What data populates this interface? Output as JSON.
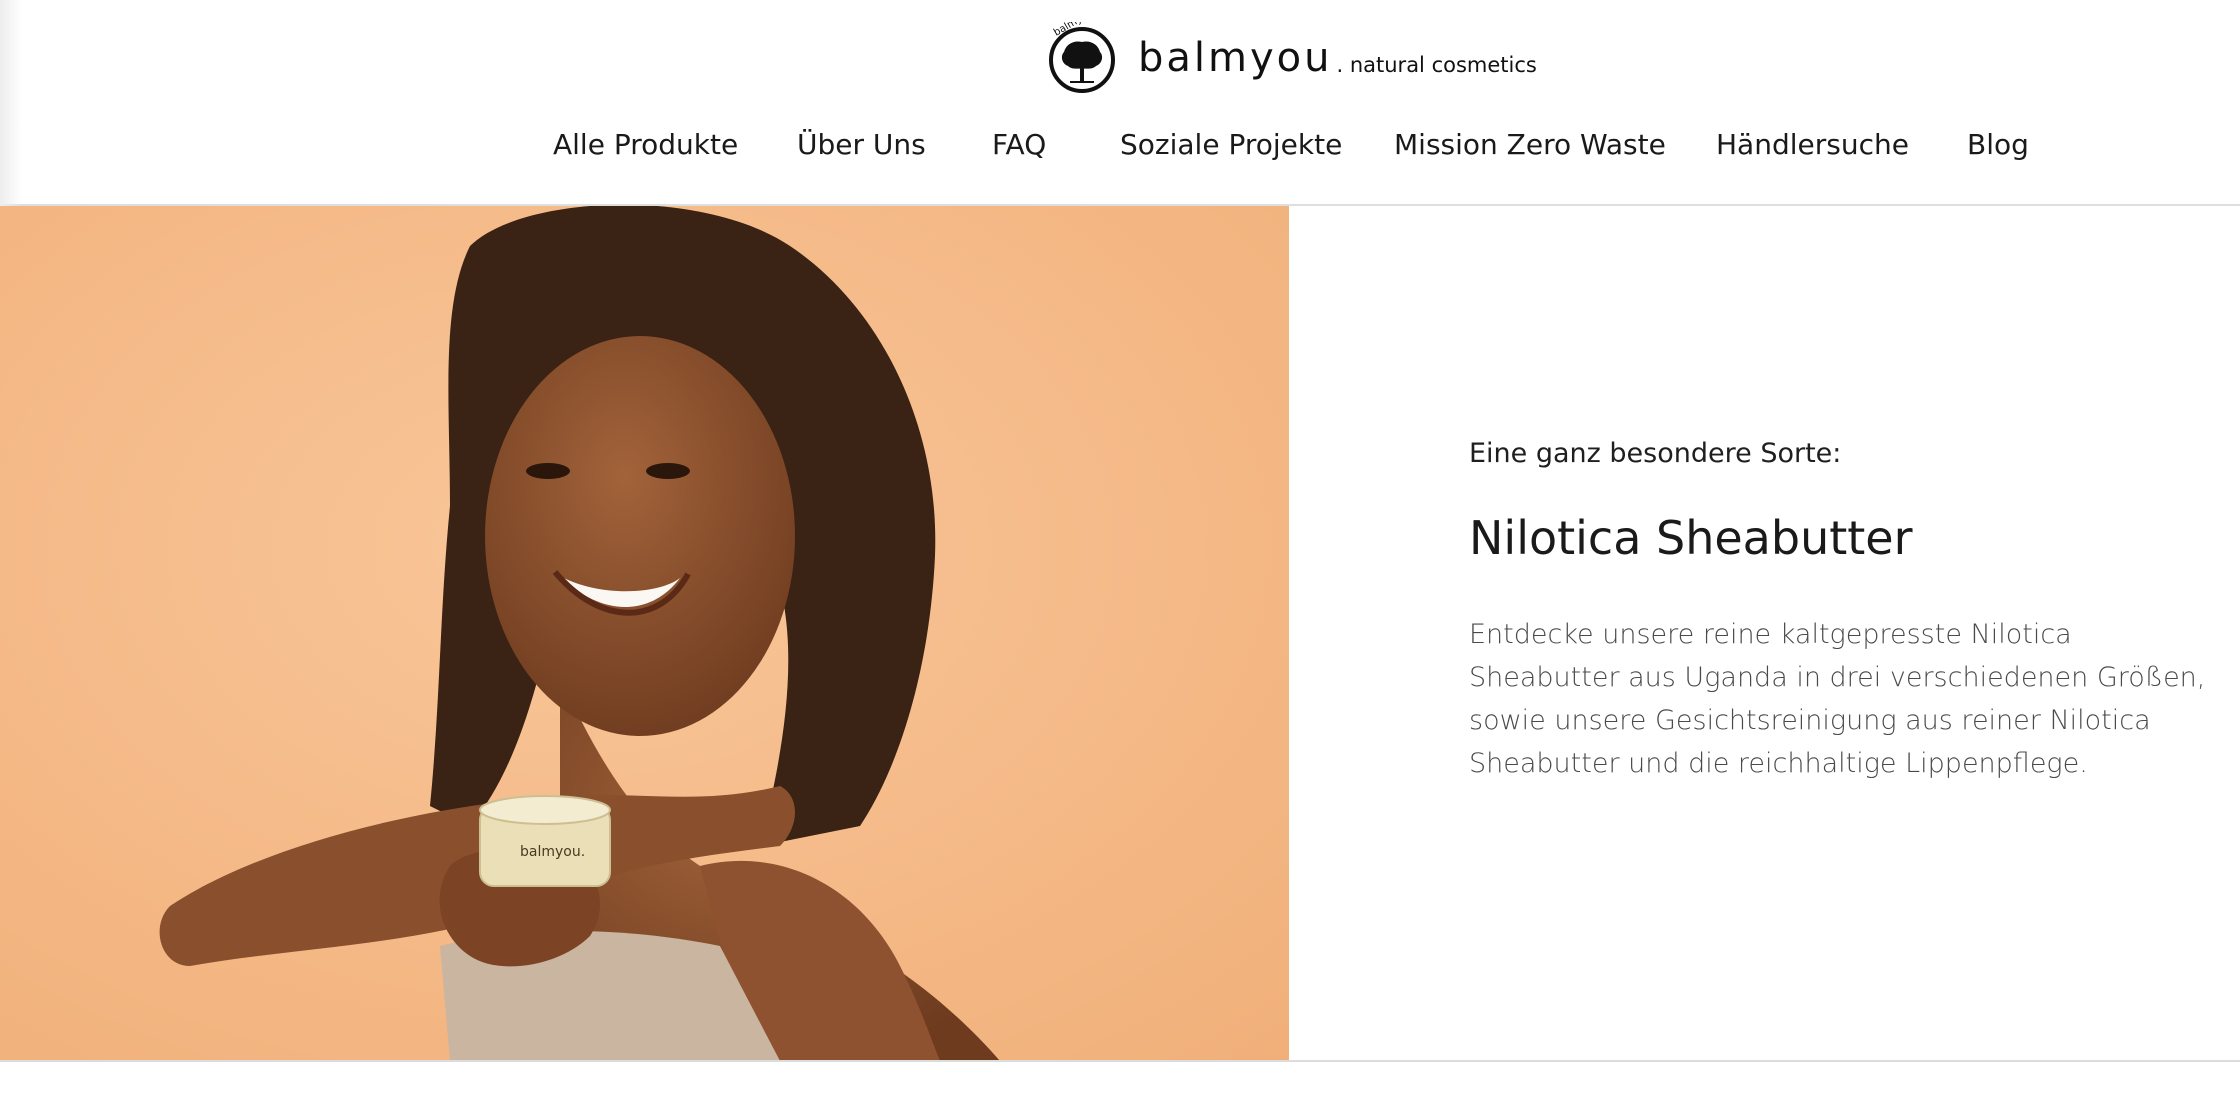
{
  "header": {
    "brand": "balmyou",
    "brand_suffix": ". natural cosmetics",
    "logo_ring_text": "balmyou"
  },
  "nav": {
    "items": [
      {
        "label": "Alle Produkte"
      },
      {
        "label": "Über Uns"
      },
      {
        "label": "FAQ"
      },
      {
        "label": "Soziale Projekte"
      },
      {
        "label": "Mission Zero Waste"
      },
      {
        "label": "Händlersuche"
      },
      {
        "label": "Blog"
      }
    ]
  },
  "hero": {
    "image_icon": "woman-with-shea-butter-jar-photo",
    "jar_label": "balmyou.",
    "eyebrow": "Eine ganz besondere Sorte:",
    "headline": "Nilotica Sheabutter",
    "description": "Entdecke unsere reine kaltgepresste Nilotica Sheabutter aus Uganda in drei verschiedenen Größen, sowie unsere Gesichtsreinigung aus reiner Nilotica Sheabutter und die reichhaltige Lippenpflege."
  },
  "colors": {
    "hero_background": "#f7c08e",
    "skin": "#8a4f2c",
    "hair": "#3a2214",
    "towel": "#c9b5a0",
    "jar": "#eadfb6"
  }
}
